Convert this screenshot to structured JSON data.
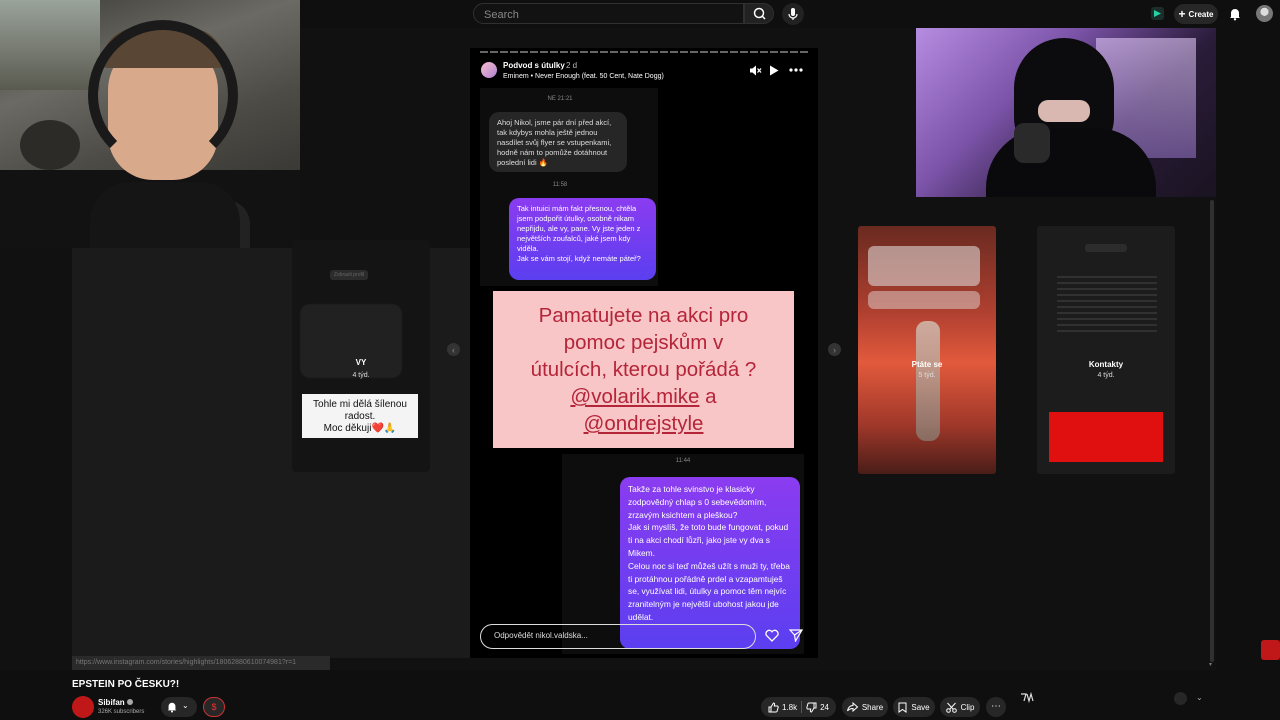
{
  "search": {
    "placeholder": "Search"
  },
  "header": {
    "create_label": "Create"
  },
  "story": {
    "author": "Podvod s útulky",
    "age": "2 d",
    "song": "Eminem • Never Enough (feat. 50 Cent, Nate Dogg)",
    "time_1": "NE 21:21",
    "msg_1": "Ahoj Nikol, jsme pár dní před akcí, tak kdybys mohla ještě jednou nasdílet svůj flyer se vstupenkami, hodně nám to pomůže dotáhnout poslední lidi 🔥",
    "time_2": "11:58",
    "msg_2": "Tak intuici mám fakt přesnou, chtěla jsem podpořit útulky, osobně nikam nepřijdu, ale vy, pane. Vy jste jeden z největších zoufalců, jaké jsem kdy viděla.\nJak se vám stojí, když nemáte páteř?",
    "card_line1": "Pamatujete na akci pro",
    "card_line2": "pomoc pejskům v",
    "card_line3": "útulcích, kterou pořádá ?",
    "card_handle1": "@volarik.mike",
    "card_and": "a",
    "card_handle2": "@ondrejstyle",
    "time_3": "11:44",
    "msg_3": "Takže za tohle svinstvo je klasicky zodpovědný chlap s 0 sebevědomím, zrzavým ksichtem a pleškou?\nJak si myslíš, že toto bude fungovat, pokud ti na akci chodí lůzři, jako jste vy dva s Mikem.\nCelou noc si teď můžeš užít s muži ty, třeba ti protáhnou pořádně prdel a vzapamtuješ se, využívat lidi, útulky a pomoc těm nejvíc zranitelným je největší ubohost jakou jde udělat.",
    "reply_placeholder": "Odpovědět nikol.valdska..."
  },
  "left_highlight": {
    "label": "Zobrazit profil",
    "title": "VY",
    "age": "4 týd.",
    "caption": "Tohle mi dělá šílenou radost.\nMoc děkuji❤️🙏"
  },
  "highlights": [
    {
      "title": "Ptáte se",
      "age": "5 týd."
    },
    {
      "title": "Kontakty",
      "age": "4 týd."
    }
  ],
  "url_bar": "https://www.instagram.com/stories/highlights/18062880610074981?r=1",
  "video": {
    "title": "EPSTEIN PO ČESKU?!",
    "channel": "Sibifan",
    "subscribers": "326K subscribers",
    "likes": "1.8k",
    "dislikes": "24",
    "share_label": "Share",
    "save_label": "Save",
    "clip_label": "Clip"
  },
  "colors": {
    "accent": "#7b3df0",
    "pink_card": "#f8c6c6",
    "card_text": "#b5253a",
    "brand_red": "#c01818"
  },
  "icons": [
    "search-icon",
    "mic-icon",
    "plus-icon",
    "bell-icon",
    "mute-icon",
    "play-icon",
    "more-icon",
    "heart-icon",
    "send-icon",
    "like-icon",
    "dislike-icon",
    "share-icon",
    "save-icon",
    "clip-icon"
  ]
}
